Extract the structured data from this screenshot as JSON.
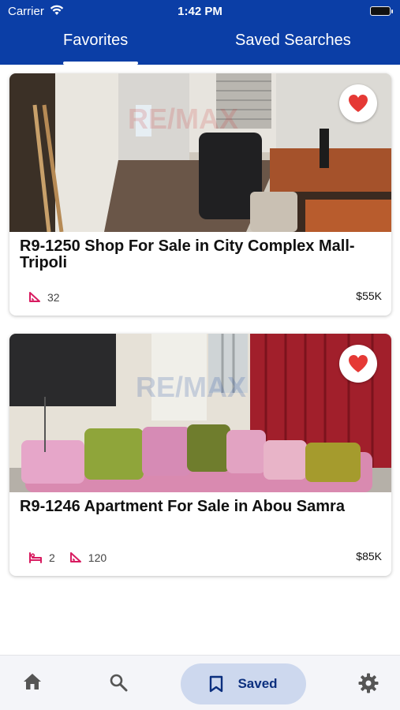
{
  "status_bar": {
    "carrier": "Carrier",
    "time": "1:42 PM"
  },
  "tabs": [
    {
      "label": "Favorites",
      "active": true
    },
    {
      "label": "Saved Searches",
      "active": false
    }
  ],
  "listings": [
    {
      "title": "R9-1250 Shop For Sale in City Complex Mall-Tripoli",
      "area": "32",
      "price": "$55K",
      "favorited": true
    },
    {
      "title": "R9-1246 Apartment For Sale in Abou Samra",
      "bedrooms": "2",
      "area": "120",
      "price": "$85K",
      "favorited": true
    }
  ],
  "bottom_nav": {
    "items": [
      "home-icon",
      "search-icon",
      "bookmark-icon",
      "gear-icon"
    ],
    "saved_label": "Saved",
    "active": "Saved"
  },
  "colors": {
    "brand_blue": "#0b3ea6",
    "heart_red": "#e53935",
    "icon_pink": "#d81b60"
  }
}
